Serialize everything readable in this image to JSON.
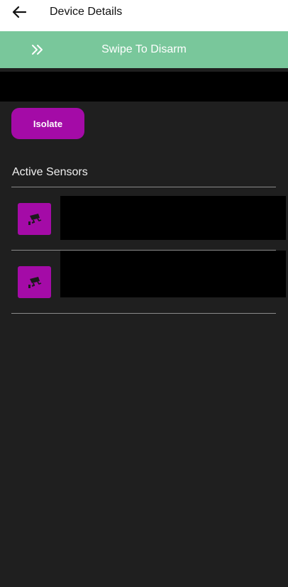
{
  "header": {
    "back_icon": "arrow-left-icon",
    "title": "Device Details"
  },
  "swipe": {
    "icon": "double-chevron-right-icon",
    "label": "Swipe To Disarm",
    "color": "#79c79b"
  },
  "actions": {
    "isolate_label": "Isolate",
    "accent_color": "#a40ba7"
  },
  "sensors": {
    "section_title": "Active Sensors",
    "icon": "security-camera-icon",
    "items": [
      {
        "icon": "security-camera-icon"
      },
      {
        "icon": "security-camera-icon"
      }
    ]
  }
}
